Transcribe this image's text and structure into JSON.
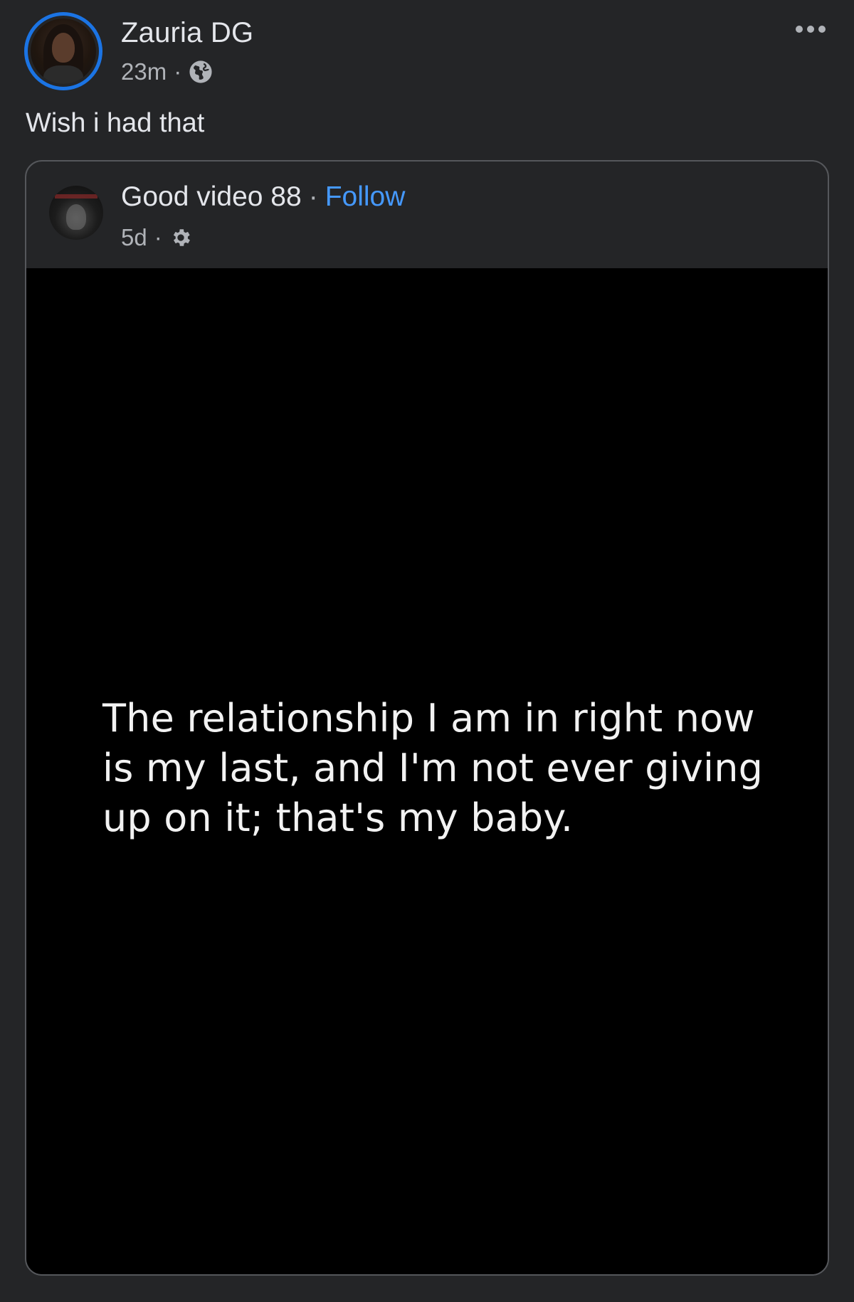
{
  "post": {
    "author_name": "Zauria DG",
    "time": "23m",
    "separator": "·",
    "privacy_icon": "globe-icon",
    "more_icon": "more-horizontal-icon",
    "text": "Wish i had that"
  },
  "shared": {
    "page_name": "Good video 88",
    "separator": "·",
    "follow_label": "Follow",
    "time": "5d",
    "privacy_icon": "gear-icon",
    "video_caption": "The relationship I am in right now is my last, and I'm not ever giving up on it; that's my baby."
  },
  "colors": {
    "background": "#242527",
    "text_primary": "#e4e6eb",
    "text_secondary": "#b0b3b8",
    "accent_link": "#4599ff",
    "story_ring": "#1b74e4",
    "video_bg": "#000000"
  }
}
